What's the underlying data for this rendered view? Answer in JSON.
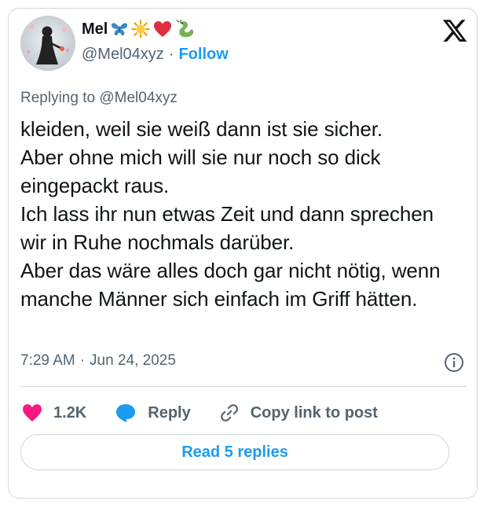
{
  "author": {
    "name": "Mel",
    "name_emojis": [
      "butterfly-icon",
      "sun-icon",
      "heart-icon",
      "dragon-icon"
    ],
    "handle": "@Mel04xyz",
    "separator": "·",
    "follow_label": "Follow"
  },
  "reply_context": {
    "prefix": "Replying to",
    "mention": "@Mel04xyz"
  },
  "tweet": {
    "text": "kleiden, weil sie weiß dann ist sie sicher.\nAber ohne mich will sie nur noch so dick eingepackt raus.\nIch lass ihr nun etwas Zeit und dann sprechen wir in Ruhe nochmals darüber.\nAber das wäre alles doch gar nicht nötig, wenn manche Männer sich einfach im Griff hätten.",
    "time": "7:29 AM",
    "date_separator": "·",
    "date": "Jun 24, 2025"
  },
  "actions": {
    "like_count": "1.2K",
    "reply_label": "Reply",
    "copy_label": "Copy link to post"
  },
  "read_replies_label": "Read 5 replies",
  "colors": {
    "accent": "#1d9bf0",
    "like": "#f91880",
    "reply_icon": "#1d9bf0",
    "muted": "#536471",
    "border": "#cfd9de"
  }
}
